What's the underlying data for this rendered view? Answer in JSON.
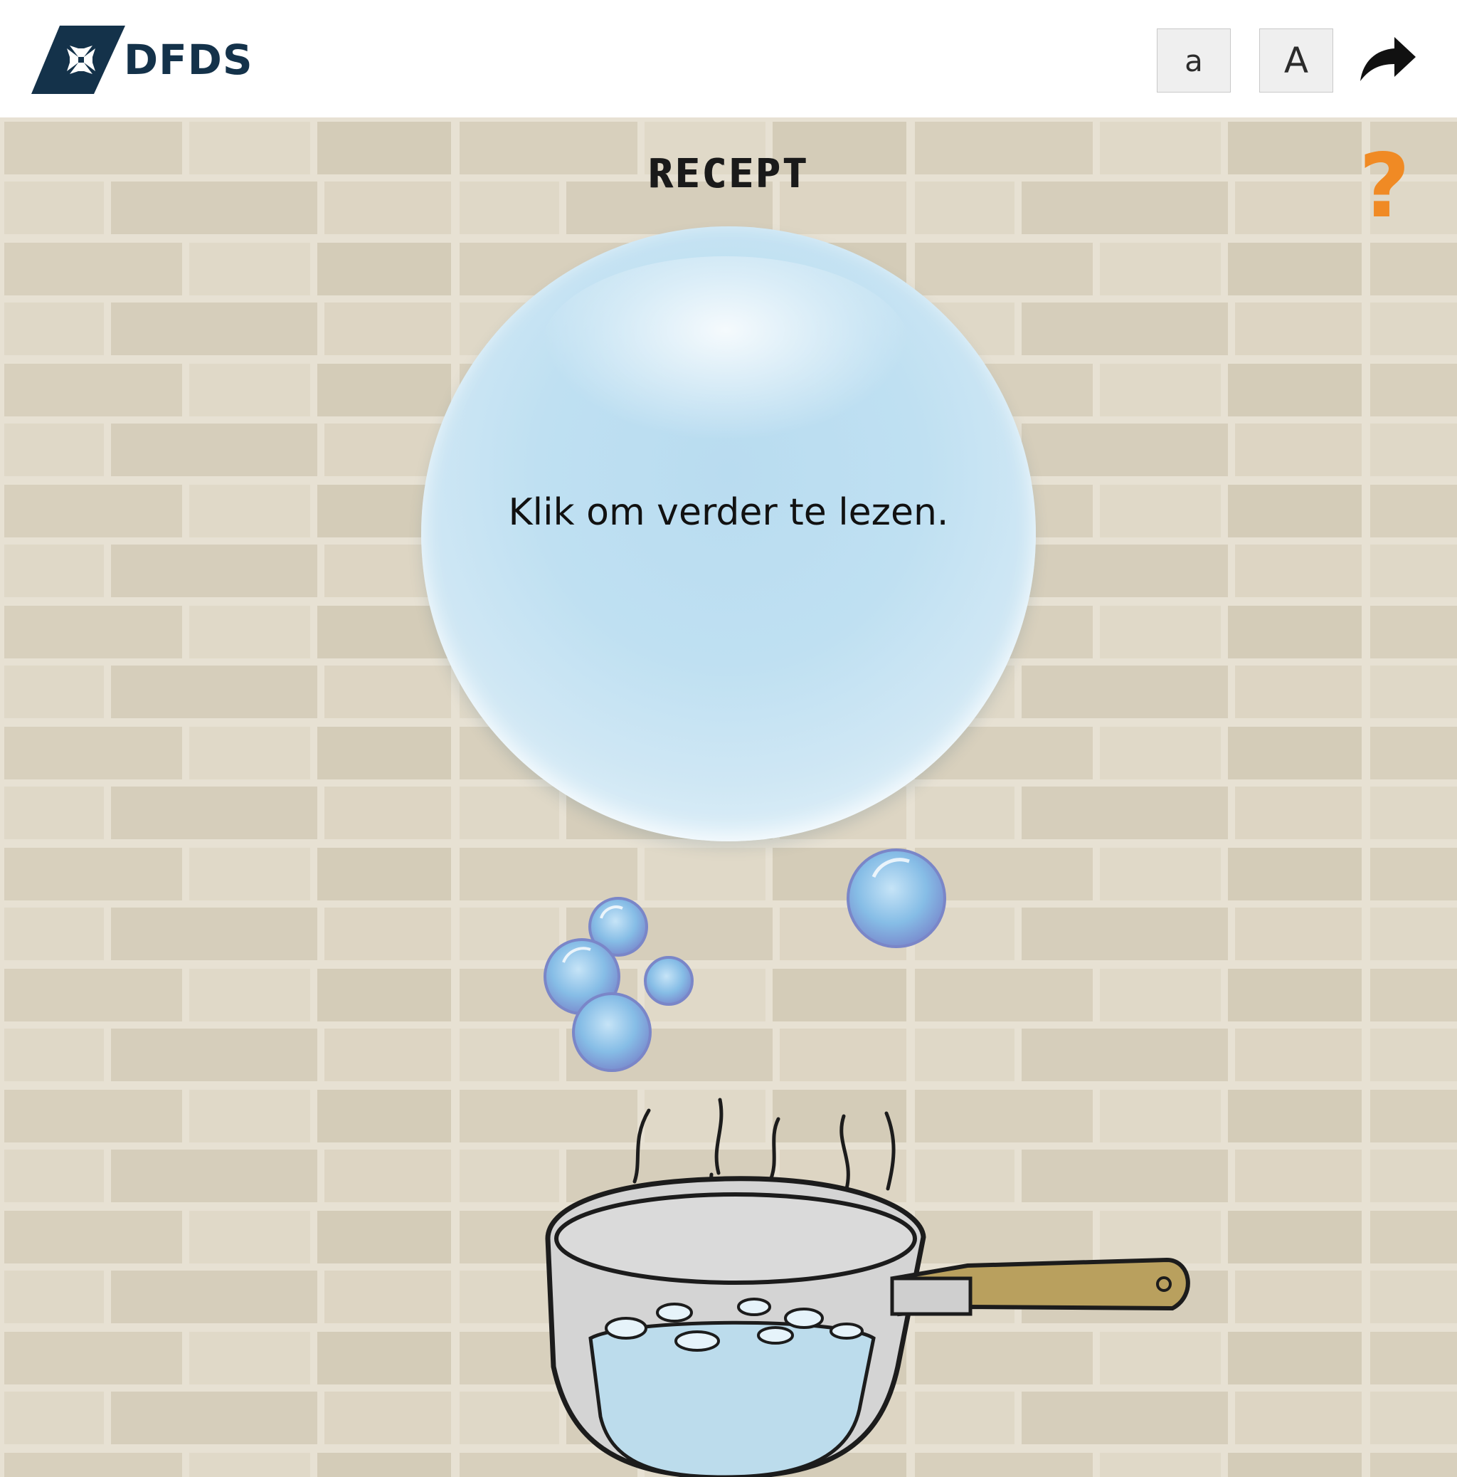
{
  "header": {
    "logo_text": "DFDS",
    "font_small_label": "a",
    "font_large_label": "A",
    "share_icon": "share-arrow-icon"
  },
  "page": {
    "title": "RECEPT",
    "help_label": "?",
    "bubble_text": "Klik om verder te lezen."
  },
  "colors": {
    "brand_navy": "#14324a",
    "help_orange": "#f08a24",
    "wall": "#ddd6c6",
    "water": "#bcdcec",
    "handle": "#b9a05e"
  }
}
